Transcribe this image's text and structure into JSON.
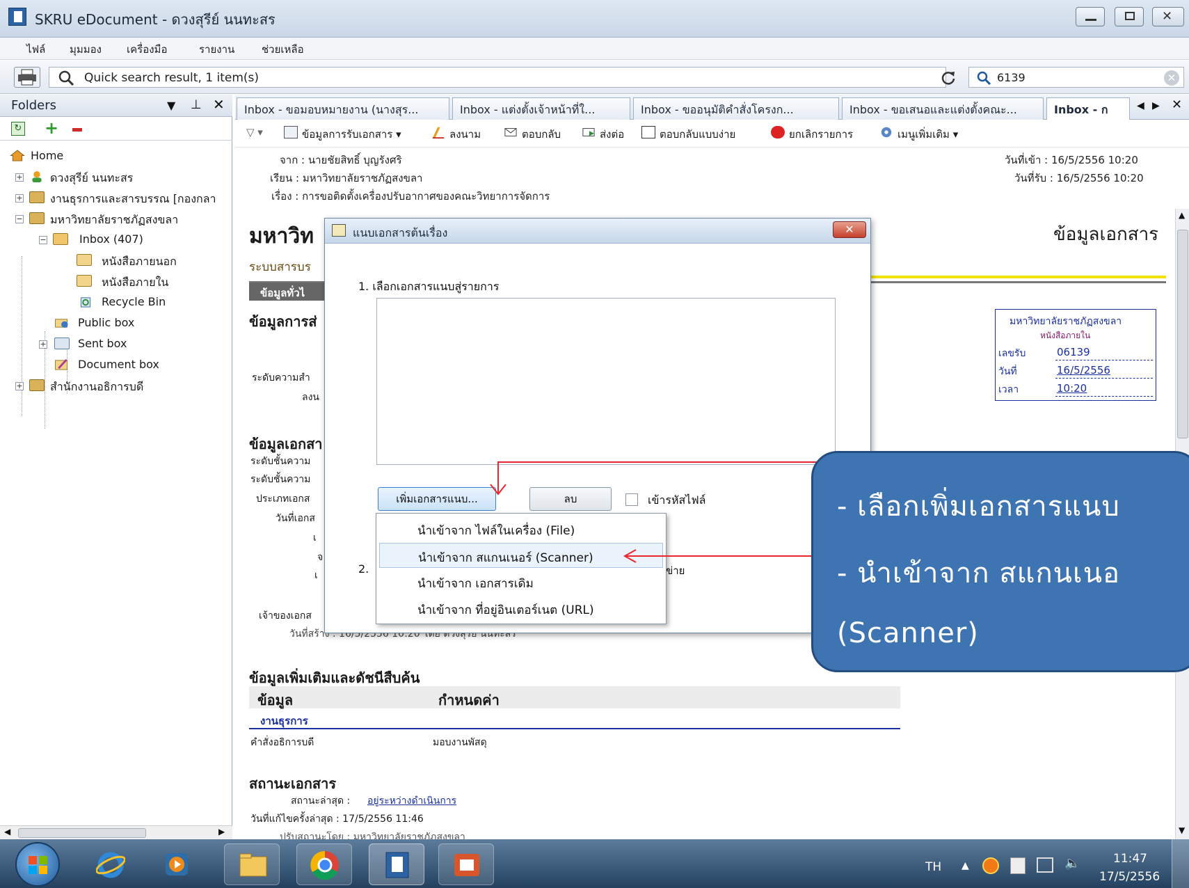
{
  "window": {
    "title": "SKRU eDocument - ดวงสุรีย์ นนทะสร"
  },
  "menu": [
    "ไฟล์",
    "มุมมอง",
    "เครื่องมือ",
    "รายงาน",
    "ช่วยเหลือ"
  ],
  "toolbar": {
    "quick_search_text": "Quick search result, 1 item(s)",
    "search_value": "6139"
  },
  "folders": {
    "title": "Folders",
    "tree": [
      {
        "label": "Home"
      },
      {
        "label": "ดวงสุรีย์ นนทะสร"
      },
      {
        "label": "งานธุรการและสารบรรณ [กองกลา"
      },
      {
        "label": "มหาวิทยาลัยราชภัฏสงขลา"
      },
      {
        "label": "Inbox (407)"
      },
      {
        "label": "หนังสือภายนอก"
      },
      {
        "label": "หนังสือภายใน"
      },
      {
        "label": "Recycle Bin"
      },
      {
        "label": "Public box"
      },
      {
        "label": "Sent box"
      },
      {
        "label": "Document box"
      },
      {
        "label": "สำนักงานอธิการบดี"
      }
    ]
  },
  "tabs": [
    {
      "label": "Inbox - ขอมอบหมายงาน (นางสุร..."
    },
    {
      "label": "Inbox - แต่งตั้งเจ้าหน้าที่ใ..."
    },
    {
      "label": "Inbox - ขออนุมัติคำสั่งโครงก..."
    },
    {
      "label": "Inbox - ขอเสนอและแต่งตั้งคณะ..."
    },
    {
      "label": "Inbox - ก"
    }
  ],
  "actions": {
    "receive_info": "ข้อมูลการรับเอกสาร",
    "sign": "ลงนาม",
    "reply": "ตอบกลับ",
    "forward": "ส่งต่อ",
    "simple_reply": "ตอบกลับแบบง่าย",
    "cancel": "ยกเลิกรายการ",
    "more_menu": "เมนูเพิ่มเติม"
  },
  "message": {
    "from": "จาก : นายชัยสิทธิ์ บุญรังศริ",
    "to": "เรียน : มหาวิทยาลัยราชภัฏสงขลา",
    "subject": "เรื่อง : การขอติดตั้งเครื่องปรับอากาศของคณะวิทยาการจัดการ",
    "received_in": "วันที่เข้า : 16/5/2556 10:20",
    "received": "วันที่รับ : 16/5/2556 10:20"
  },
  "doc": {
    "heading": "มหาวิท",
    "subheading": "ระบบสารบร",
    "right_heading": "ข้อมูลเอกสาร",
    "general_tab": "ข้อมูลทั่วไ",
    "send_info": "ข้อมูลการส่",
    "urgency": "ระดับความสำ",
    "sign_label": "ลงน",
    "doc_info": "ข้อมูลเอกสา",
    "class1": "ระดับชั้นความ",
    "class2": "ระดับชั้นความ",
    "doc_type": "ประเภทเอกส",
    "doc_date": "วันที่เอกส",
    "row_re1": "เ",
    "row_re2": "จ",
    "row_re3": "เ",
    "owner": "เจ้าของเอกส",
    "created": "วันที่สร้าง : 16/5/2556 10:20 โดย ดวงสุรีย์ นนทะสร",
    "extra_title": "ข้อมูลเพิ่มเติมและดัชนีสืบค้น",
    "col_data": "ข้อมูล",
    "col_value": "กำหนดค่า",
    "group": "งานธุรการ",
    "order_label": "คำสั่งอธิการบดี",
    "order_value": "มอบงานพัสดุ",
    "status_title": "สถานะเอกสาร",
    "latest_status_label": "สถานะล่าสุด :",
    "latest_status_value": "อยู่ระหว่างดำเนินการ",
    "last_edit": "วันที่แก้ไขครั้งล่าสุด : 17/5/2556 11:46",
    "updated_by": "ปรับสถานะโดย : มหาวิทยาลัยราชภัฏสงขลา"
  },
  "stamp": {
    "org": "มหาวิทยาลัยราชภัฏสงขลา",
    "type": "หนังสือภายใน",
    "num_label": "เลขรับ",
    "num_value": "06139",
    "date_label": "วันที่",
    "date_value": "16/5/2556",
    "time_label": "เวลา",
    "time_value": "10:20"
  },
  "dialog": {
    "title": "แนบเอกสารต้นเรื่อง",
    "step1": "1. เลือกเอกสารแนบสู่รายการ",
    "add_button": "เพิ่มเอกสารแนบ...",
    "delete_button": "ลบ",
    "encrypt_label": "เข้ารหัสไฟล์",
    "step2": "2. ",
    "step2_tail": "ข่าย",
    "close_symbol": "✕"
  },
  "popup": [
    "นำเข้าจาก ไฟล์ในเครื่อง (File)",
    "นำเข้าจาก สแกนเนอร์ (Scanner)",
    "นำเข้าจาก เอกสารเดิม",
    "นำเข้าจาก ที่อยู่อินเตอร์เนต (URL)"
  ],
  "callout": {
    "line1": "- เลือกเพิ่มเอกสารแนบ",
    "line2": "- นำเข้าจาก สแกนเนอ",
    "line3": "(Scanner)"
  },
  "taskbar": {
    "lang": "TH",
    "time": "11:47",
    "date": "17/5/2556"
  },
  "colors": {
    "callout": "#3f74b3",
    "arrow": "#e8262b",
    "accent_yellow": "#f2e200",
    "link": "#1a2fa0"
  }
}
